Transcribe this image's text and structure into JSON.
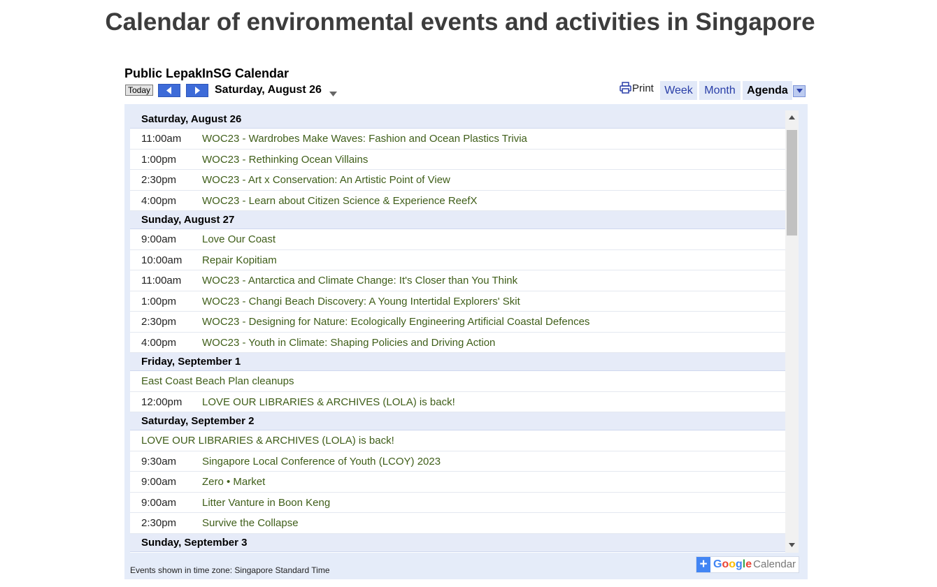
{
  "page": {
    "title": "Calendar of environmental events and activities in Singapore"
  },
  "calendar": {
    "title": "Public LepakInSG Calendar",
    "today_label": "Today",
    "current_date": "Saturday, August 26",
    "print_label": "Print",
    "tabs": {
      "week": "Week",
      "month": "Month",
      "agenda": "Agenda"
    },
    "active_tab": "Agenda",
    "colors": {
      "event_text": "#3f5e19",
      "day_header_bg": "#e6ebf8",
      "tab_bg": "#e2e9f8",
      "nav_button": "#3d6bd8"
    }
  },
  "agenda": {
    "days": [
      {
        "header": "Saturday, August 26",
        "events": [
          {
            "time": "11:00am",
            "title": "WOC23 - Wardrobes Make Waves: Fashion and Ocean Plastics Trivia"
          },
          {
            "time": "1:00pm",
            "title": "WOC23 - Rethinking Ocean Villains"
          },
          {
            "time": "2:30pm",
            "title": "WOC23 - Art x Conservation: An Artistic Point of View"
          },
          {
            "time": "4:00pm",
            "title": "WOC23 - Learn about Citizen Science & Experience ReefX"
          }
        ]
      },
      {
        "header": "Sunday, August 27",
        "events": [
          {
            "time": "9:00am",
            "title": "Love Our Coast"
          },
          {
            "time": "10:00am",
            "title": "Repair Kopitiam"
          },
          {
            "time": "11:00am",
            "title": "WOC23 - Antarctica and Climate Change: It's Closer than You Think"
          },
          {
            "time": "1:00pm",
            "title": "WOC23 - Changi Beach Discovery: A Young Intertidal Explorers' Skit"
          },
          {
            "time": "2:30pm",
            "title": "WOC23 - Designing for Nature: Ecologically Engineering Artificial Coastal Defences"
          },
          {
            "time": "4:00pm",
            "title": "WOC23 - Youth in Climate: Shaping Policies and Driving Action"
          }
        ]
      },
      {
        "header": "Friday, September 1",
        "events": [
          {
            "time": "",
            "title": "East Coast Beach Plan cleanups"
          },
          {
            "time": "12:00pm",
            "title": "LOVE OUR LIBRARIES & ARCHIVES (LOLA) is back!"
          }
        ]
      },
      {
        "header": "Saturday, September 2",
        "events": [
          {
            "time": "",
            "title": "LOVE OUR LIBRARIES & ARCHIVES (LOLA) is back!"
          },
          {
            "time": "9:30am",
            "title": "Singapore Local Conference of Youth (LCOY) 2023"
          },
          {
            "time": "9:00am",
            "title": "Zero • Market"
          },
          {
            "time": "9:00am",
            "title": "Litter Vanture in Boon Keng"
          },
          {
            "time": "2:30pm",
            "title": "Survive the Collapse"
          }
        ]
      },
      {
        "header": "Sunday, September 3",
        "events": []
      }
    ]
  },
  "footer": {
    "timezone_text": "Events shown in time zone: Singapore Standard Time",
    "badge_plus": "+",
    "badge_google": "Google",
    "badge_calendar": "Calendar",
    "google_colors": [
      "#4285f4",
      "#ea4335",
      "#fbbc05",
      "#4285f4",
      "#34a853",
      "#ea4335"
    ]
  },
  "icons": [
    "printer-icon",
    "chevron-left-icon",
    "chevron-right-icon",
    "caret-down-icon",
    "scroll-up-icon",
    "scroll-down-icon"
  ]
}
